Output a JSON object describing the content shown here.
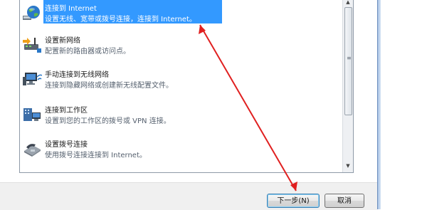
{
  "options": [
    {
      "title": "连接到 Internet",
      "desc": "设置无线、宽带或拨号连接，连接到 Internet。",
      "icon": "globe-network-icon",
      "selected": true
    },
    {
      "title": "设置新网络",
      "desc": "配置新的路由器或访问点。",
      "icon": "router-icon"
    },
    {
      "title": "手动连接到无线网络",
      "desc": "连接到隐藏网络或创建新无线配置文件。",
      "icon": "wireless-computer-icon"
    },
    {
      "title": "连接到工作区",
      "desc": "设置到您的工作区的拨号或 VPN 连接。",
      "icon": "vpn-workplace-icon"
    },
    {
      "title": "设置拨号连接",
      "desc": "使用拨号连接连接到 Internet。",
      "icon": "dialup-phone-icon"
    }
  ],
  "buttons": {
    "next_label": "下一步(N)",
    "cancel_label": "取消"
  },
  "colors": {
    "selection": "#3399ff",
    "annotation_arrow": "#e02020"
  }
}
